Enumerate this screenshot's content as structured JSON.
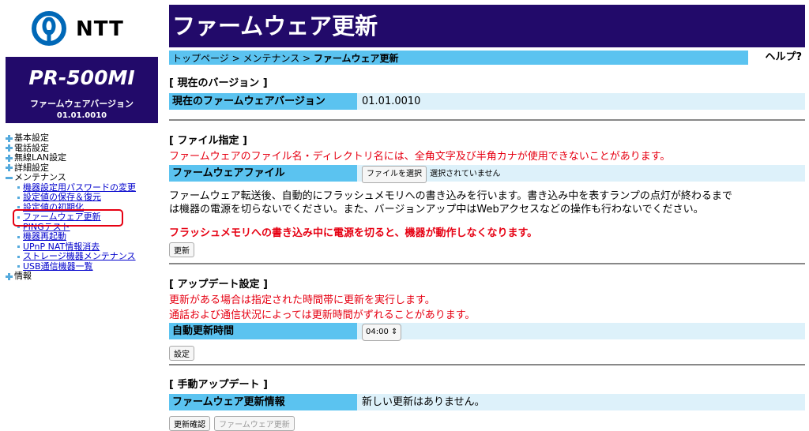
{
  "brand": {
    "name": "NTT",
    "logo_icon": "ntt-logo-icon"
  },
  "device": {
    "model": "PR-500MI",
    "fw_label": "ファームウェアバージョン",
    "fw_version": "01.01.0010"
  },
  "nav": {
    "items": [
      {
        "label": "基本設定",
        "icon": "plus-icon"
      },
      {
        "label": "電話設定",
        "icon": "plus-icon"
      },
      {
        "label": "無線LAN設定",
        "icon": "plus-icon"
      },
      {
        "label": "詳細設定",
        "icon": "plus-icon"
      },
      {
        "label": "メンテナンス",
        "icon": "minus-icon"
      }
    ],
    "maintenance_sub": [
      "機器設定用パスワードの変更",
      "設定値の保存＆復元",
      "設定値の初期化",
      "ファームウェア更新",
      "PINGテスト",
      "機器再起動",
      "UPnP NAT情報消去",
      "ストレージ機器メンテナンス",
      "USB通信機器一覧"
    ],
    "last": {
      "label": "情報",
      "icon": "plus-icon"
    }
  },
  "page": {
    "title": "ファームウェア更新"
  },
  "breadcrumb": {
    "part1": "トップページ > メンテナンス > ",
    "current": "ファームウェア更新",
    "help": "ヘルプ?"
  },
  "current_version": {
    "title": "[ 現在のバージョン ]",
    "label": "現在のファームウェアバージョン",
    "value": "01.01.0010"
  },
  "file": {
    "title": "[ ファイル指定 ]",
    "warning": "ファームウェアのファイル名・ディレクトリ名には、全角文字及び半角カナが使用できないことがあります。",
    "label": "ファームウェアファイル",
    "choose_button": "ファイルを選択",
    "no_file": "選択されていません",
    "info_line1": "ファームウェア転送後、自動的にフラッシュメモリへの書き込みを行います。書き込み中を表すランプの点灯が終わるまで",
    "info_line2": "は機器の電源を切らないでください。また、バージョンアップ中はWebアクセスなどの操作も行わないでください。",
    "danger": "フラッシュメモリへの書き込み中に電源を切ると、機器が動作しなくなります。",
    "update_button": "更新"
  },
  "update_setting": {
    "title": "[ アップデート設定 ]",
    "note1": "更新がある場合は指定された時間帯に更新を実行します。",
    "note2": "通話および通信状況によっては更新時間がずれることがあります。",
    "label": "自動更新時間",
    "time": "04:00",
    "set_button": "設定"
  },
  "manual": {
    "title": "[ 手動アップデート ]",
    "label": "ファームウェア更新情報",
    "value": "新しい更新はありません。",
    "check_button": "更新確認",
    "fw_update_button": "ファームウェア更新"
  },
  "colors": {
    "accent": "#220a6a",
    "bar": "#5bc3f0",
    "row": "#ddf1fa",
    "warning": "#e60012"
  }
}
